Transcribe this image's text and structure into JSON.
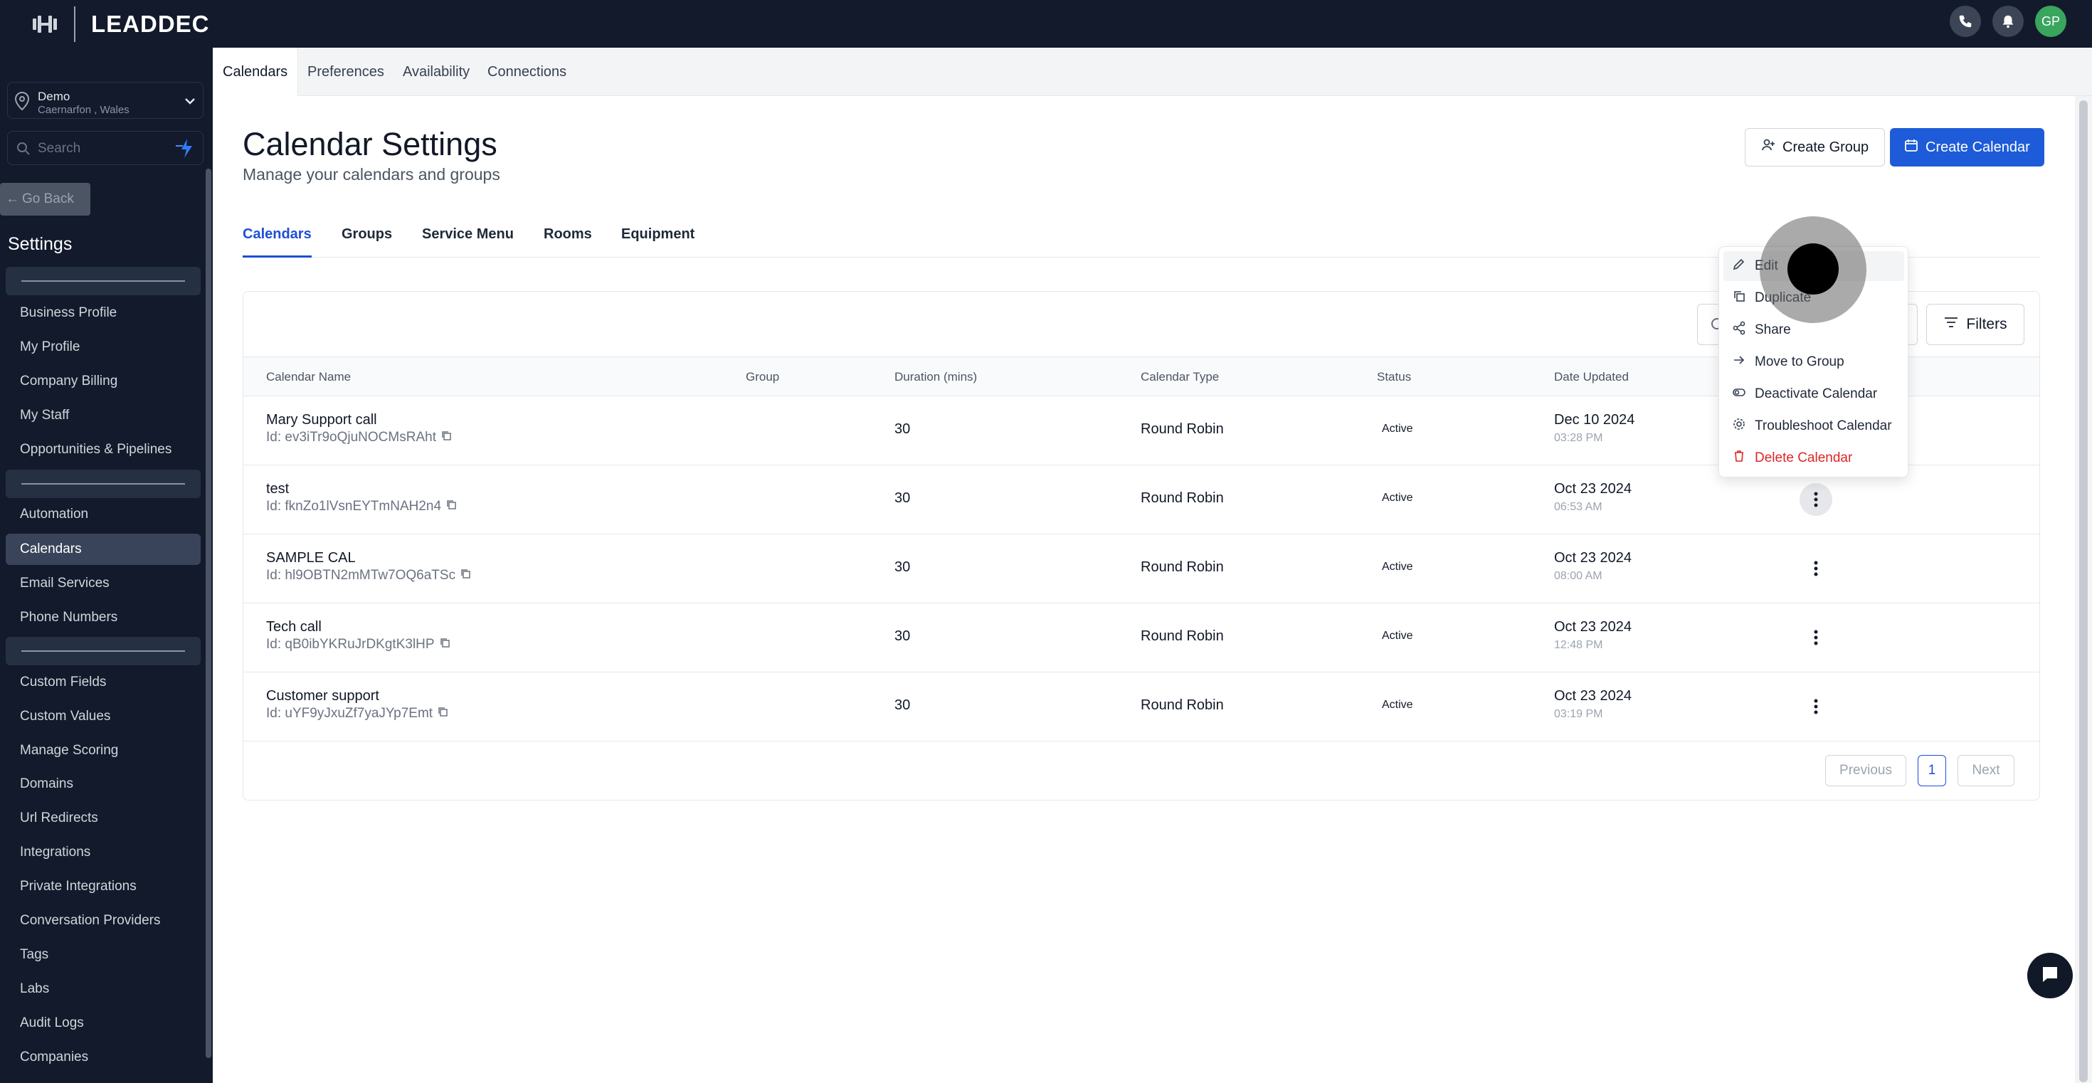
{
  "app": {
    "brand": "LEADDEC"
  },
  "topbar": {
    "avatar_initials": "GP",
    "icons": [
      "phone-icon",
      "bell-icon"
    ]
  },
  "sidebar": {
    "location": {
      "name": "Demo",
      "sub": "Caernarfon , Wales"
    },
    "search_placeholder": "Search",
    "go_back": "Go Back",
    "title": "Settings",
    "items": [
      "Business Profile",
      "My Profile",
      "Company Billing",
      "My Staff",
      "Opportunities & Pipelines",
      "Automation",
      "Calendars",
      "Email Services",
      "Phone Numbers",
      "Custom Fields",
      "Custom Values",
      "Manage Scoring",
      "Domains",
      "Url Redirects",
      "Integrations",
      "Private Integrations",
      "Conversation Providers",
      "Tags",
      "Labs",
      "Audit Logs",
      "Companies"
    ],
    "active_item": "Calendars"
  },
  "top_tabs": [
    "Calendars",
    "Preferences",
    "Availability",
    "Connections"
  ],
  "page": {
    "title": "Calendar Settings",
    "subtitle": "Manage your calendars and groups",
    "create_group": "Create Group",
    "create_calendar": "Create Calendar"
  },
  "sub_tabs": [
    "Calendars",
    "Groups",
    "Service Menu",
    "Rooms",
    "Equipment"
  ],
  "table": {
    "filters_label": "Filters",
    "columns": [
      "Calendar Name",
      "Group",
      "Duration (mins)",
      "Calendar Type",
      "Status",
      "Date Updated"
    ],
    "rows": [
      {
        "name": "Mary Support call",
        "id": "Id: ev3iTr9oQjuNOCMsRAht",
        "duration": "30",
        "type": "Round Robin",
        "status": "Active",
        "date": "Dec 10 2024",
        "time": "03:28 PM"
      },
      {
        "name": "test",
        "id": "Id: fknZo1lVsnEYTmNAH2n4",
        "duration": "30",
        "type": "Round Robin",
        "status": "Active",
        "date": "Oct 23 2024",
        "time": "06:53 AM"
      },
      {
        "name": "SAMPLE CAL",
        "id": "Id: hl9OBTN2mMTw7OQ6aTSc",
        "duration": "30",
        "type": "Round Robin",
        "status": "Active",
        "date": "Oct 23 2024",
        "time": "08:00 AM"
      },
      {
        "name": "Tech call",
        "id": "Id: qB0ibYKRuJrDKgtK3lHP",
        "duration": "30",
        "type": "Round Robin",
        "status": "Active",
        "date": "Oct 23 2024",
        "time": "12:48 PM"
      },
      {
        "name": "Customer support",
        "id": "Id: uYF9yJxuZf7yaJYp7Emt",
        "duration": "30",
        "type": "Round Robin",
        "status": "Active",
        "date": "Oct 23 2024",
        "time": "03:19 PM"
      }
    ],
    "pagination": {
      "previous": "Previous",
      "page": "1",
      "next": "Next"
    }
  },
  "context_menu": {
    "items": [
      {
        "label": "Edit",
        "icon": "pencil-icon"
      },
      {
        "label": "Duplicate",
        "icon": "duplicate-icon"
      },
      {
        "label": "Share",
        "icon": "share-icon"
      },
      {
        "label": "Move to Group",
        "icon": "arrow-right-icon"
      },
      {
        "label": "Deactivate Calendar",
        "icon": "toggle-icon"
      },
      {
        "label": "Troubleshoot Calendar",
        "icon": "gear-icon"
      },
      {
        "label": "Delete Calendar",
        "icon": "trash-icon"
      }
    ]
  },
  "colors": {
    "sidebar": "#121a2b",
    "primary": "#1d5bd8",
    "danger": "#dc2626",
    "avatar": "#3aa55d"
  }
}
